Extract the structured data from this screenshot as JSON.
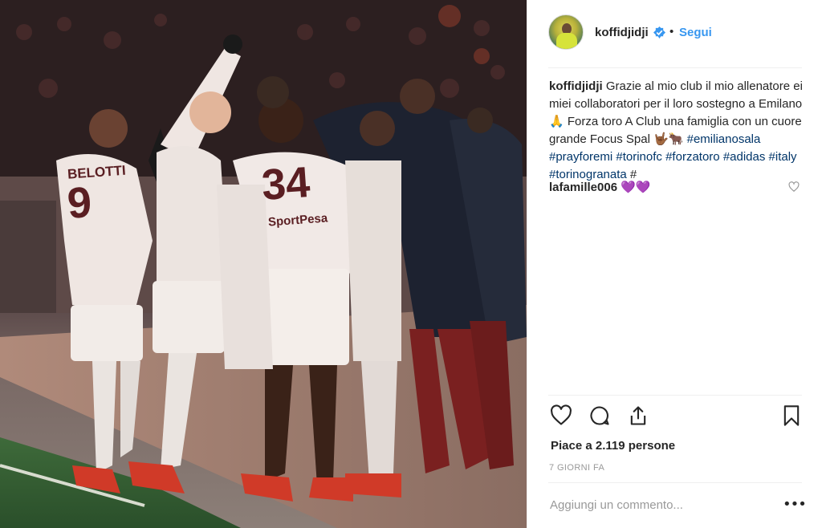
{
  "post": {
    "username": "koffidjidji",
    "follow_label": "Segui",
    "separator": "•"
  },
  "caption": {
    "username": "koffidjidji",
    "text": " Grazie al mio club il mio allenatore ei miei collaboratori per il loro sostegno a Emilano 🙏 Forza toro A Club una famiglia con un cuore grande Focus Spal 🤟🏾🐂 ",
    "hashtags": [
      "#emilianosala",
      "#prayforemi",
      "#torinofc",
      "#forzatoro",
      "#adidas",
      "#italy",
      "#torinogranata",
      "#"
    ]
  },
  "comments": [
    {
      "username": "lafamille006",
      "text": "💜💜"
    }
  ],
  "photo": {
    "jersey_numbers": [
      "9",
      "34"
    ],
    "sponsor": "SportPesa",
    "player_name": "BELOTTI"
  },
  "actions": {
    "like_icon": "heart-icon",
    "comment_icon": "comment-icon",
    "share_icon": "share-icon",
    "save_icon": "bookmark-icon"
  },
  "likes_text": "Piace a 2.119 persone",
  "timestamp": "7 giorni fa",
  "comment_input": {
    "placeholder": "Aggiungi un commento..."
  },
  "more_label": "•••",
  "colors": {
    "link": "#003569",
    "follow": "#3897f0",
    "verified": "#3897f0",
    "muted": "#999999"
  }
}
